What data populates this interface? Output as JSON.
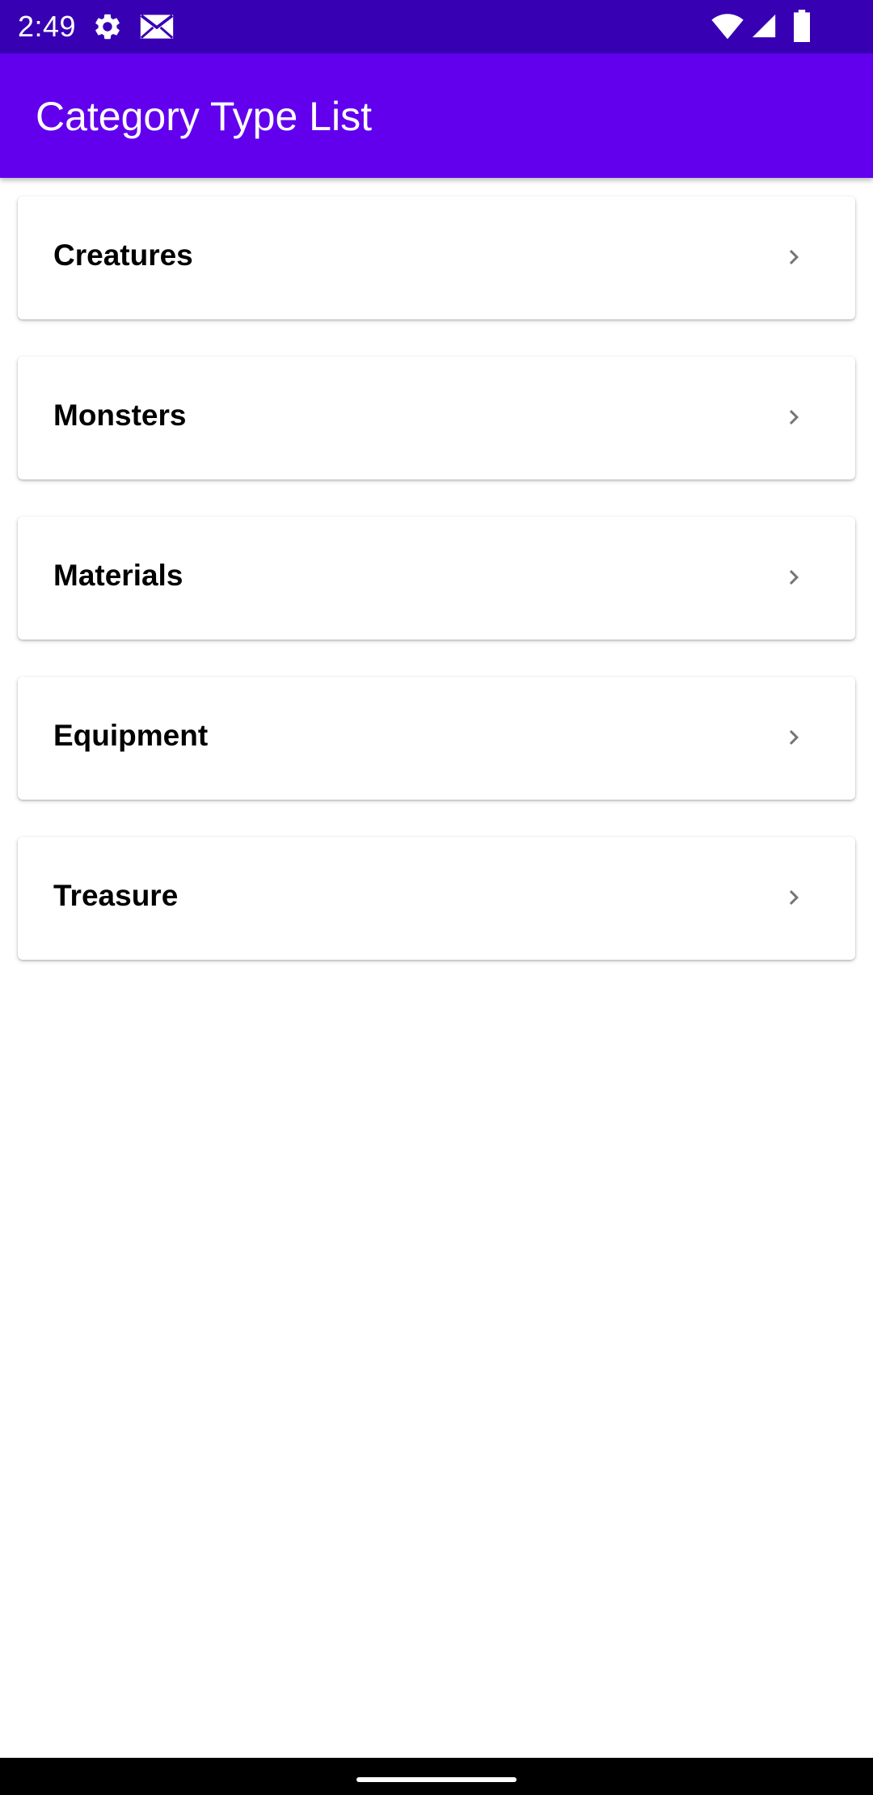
{
  "status_bar": {
    "time": "2:49",
    "left_icons": [
      "gear-icon",
      "mail-icon"
    ],
    "right_icons": [
      "wifi-icon",
      "signal-icon",
      "battery-icon"
    ],
    "background": "#3700b3"
  },
  "app_bar": {
    "title": "Category Type List",
    "background": "#6200ee"
  },
  "categories": [
    {
      "label": "Creatures",
      "icon": "chevron-right-icon"
    },
    {
      "label": "Monsters",
      "icon": "chevron-right-icon"
    },
    {
      "label": "Materials",
      "icon": "chevron-right-icon"
    },
    {
      "label": "Equipment",
      "icon": "chevron-right-icon"
    },
    {
      "label": "Treasure",
      "icon": "chevron-right-icon"
    }
  ],
  "colors": {
    "chevron": "#757575",
    "label": "#000000",
    "nav_bar": "#000000"
  }
}
